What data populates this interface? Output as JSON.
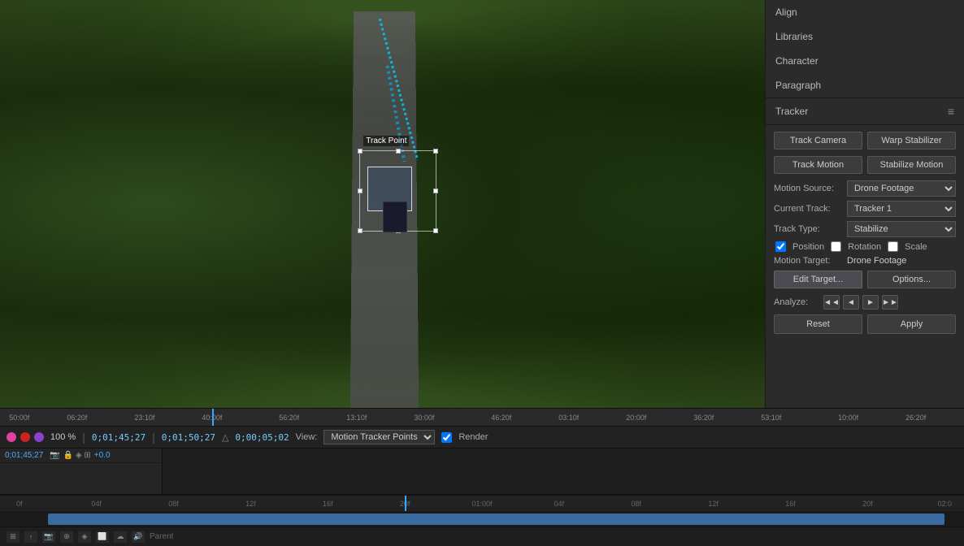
{
  "panel": {
    "title": "Tracker",
    "menu_icon": "≡",
    "sections": [
      {
        "label": "Align"
      },
      {
        "label": "Libraries"
      },
      {
        "label": "Character"
      },
      {
        "label": "Paragraph"
      }
    ],
    "buttons": {
      "track_camera": "Track Camera",
      "warp_stabilizer": "Warp Stabilizer",
      "track_motion": "Track Motion",
      "stabilize_motion": "Stabilize Motion"
    },
    "fields": {
      "motion_source_label": "Motion Source:",
      "motion_source_value": "Drone Footage",
      "current_track_label": "Current Track:",
      "current_track_value": "Tracker 1",
      "track_type_label": "Track Type:",
      "track_type_value": "Stabilize"
    },
    "checkboxes": {
      "position_label": "Position",
      "position_checked": true,
      "rotation_label": "Rotation",
      "rotation_checked": false,
      "scale_label": "Scale",
      "scale_checked": false
    },
    "motion_target": {
      "label": "Motion Target:",
      "value": "Drone Footage"
    },
    "action_buttons": {
      "edit_target": "Edit Target...",
      "options": "Options..."
    },
    "analyze": {
      "label": "Analyze:",
      "buttons": [
        "◄◄",
        "◄",
        "►",
        "►►"
      ]
    },
    "bottom_buttons": {
      "reset": "Reset",
      "apply": "Apply"
    }
  },
  "tracker_box": {
    "label": "Track Point"
  },
  "timeline": {
    "timecodes": [
      "50:00f",
      "06:20f",
      "23:10f",
      "40:00f",
      "56:20f",
      "13:10f",
      "30:00f",
      "46:20f",
      "03:10f",
      "20:00f",
      "36:20f",
      "53:10f",
      "10:00f",
      "26:20f"
    ],
    "current_time": "0;01;45;27",
    "in_point": "0;01;50;27",
    "duration": "0;00;05;02",
    "view_label": "View:",
    "view_option": "Motion Tracker Points",
    "render_label": "Render",
    "zoom": "100 %",
    "bottom_timecodes": [
      "0f",
      "04f",
      "08f",
      "12f",
      "16f",
      "20f",
      "01:00f",
      "04f",
      "08f",
      "12f",
      "16f",
      "20f",
      "02:0"
    ],
    "parent_label": "Parent"
  },
  "controls": {
    "timecode_display": "0;01;45;27",
    "offset_display": "+0.0"
  }
}
